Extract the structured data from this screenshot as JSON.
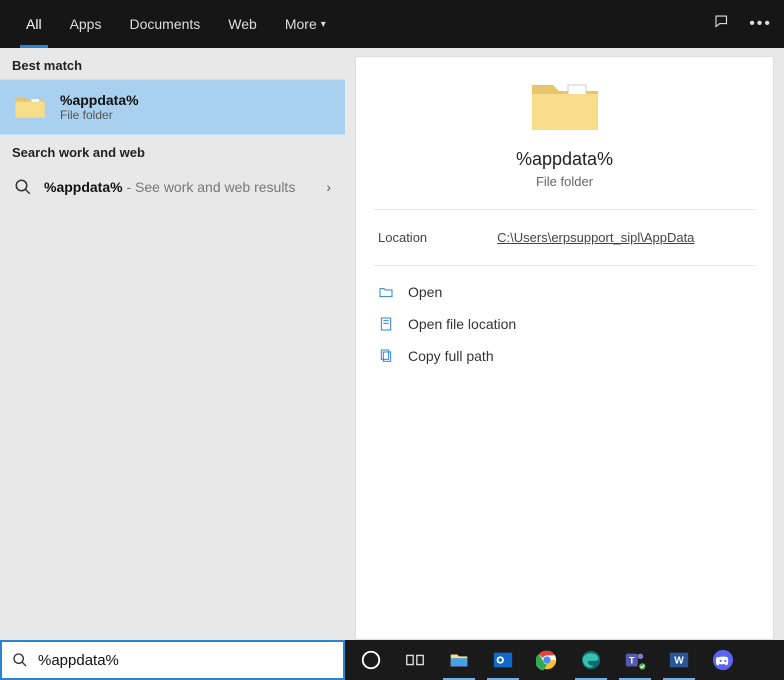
{
  "tabs": {
    "all": "All",
    "apps": "Apps",
    "documents": "Documents",
    "web": "Web",
    "more": "More"
  },
  "sections": {
    "best": "Best match",
    "sww": "Search work and web"
  },
  "bestmatch": {
    "title": "%appdata%",
    "sub": "File folder"
  },
  "webrow": {
    "term": "%appdata%",
    "suffix": " - See work and web results"
  },
  "preview": {
    "title": "%appdata%",
    "sub": "File folder",
    "location_label": "Location",
    "location_path": "C:\\Users\\erpsupport_sipl\\AppData",
    "actions": {
      "open": "Open",
      "openloc": "Open file location",
      "copy": "Copy full path"
    }
  },
  "search": {
    "value": "%appdata%"
  },
  "taskbar_icons": [
    "cortana",
    "taskview",
    "explorer",
    "outlook",
    "chrome",
    "edge",
    "teams",
    "word",
    "discord"
  ]
}
